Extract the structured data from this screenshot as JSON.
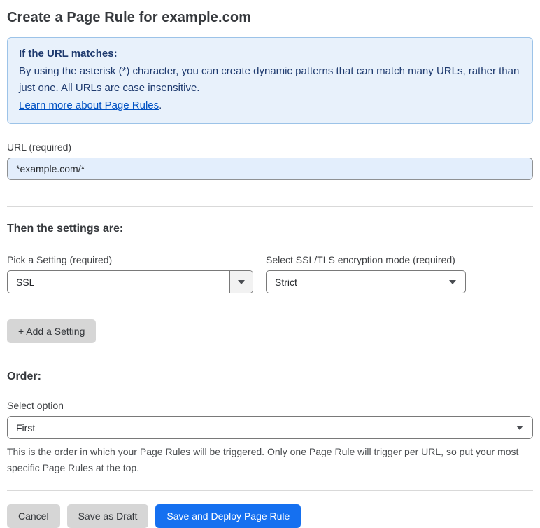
{
  "page": {
    "title": "Create a Page Rule for example.com"
  },
  "info_box": {
    "heading": "If the URL matches:",
    "body": "By using the asterisk (*) character, you can create dynamic patterns that can match many URLs, rather than just one. All URLs are case insensitive.",
    "link_label": "Learn more about Page Rules",
    "link_suffix": "."
  },
  "url_field": {
    "label": "URL (required)",
    "value": "*example.com/*"
  },
  "settings_section": {
    "heading": "Then the settings are:",
    "setting_picker": {
      "label": "Pick a Setting (required)",
      "value": "SSL"
    },
    "ssl_mode_picker": {
      "label": "Select SSL/TLS encryption mode (required)",
      "value": "Strict"
    },
    "add_setting_button": "+ Add a Setting"
  },
  "order_section": {
    "heading": "Order:",
    "select_label": "Select option",
    "selected_option": "First",
    "help_text": "This is the order in which your Page Rules will be triggered. Only one Page Rule will trigger per URL, so put your most specific Page Rules at the top."
  },
  "footer": {
    "cancel_label": "Cancel",
    "save_draft_label": "Save as Draft",
    "save_deploy_label": "Save and Deploy Page Rule"
  },
  "colors": {
    "primary_button": "#1570f0",
    "info_background": "#e8f1fb",
    "info_border": "#9cc3e8",
    "info_text": "#1e3a6e",
    "link": "#0051c3",
    "url_input_background": "#e3eefc"
  }
}
